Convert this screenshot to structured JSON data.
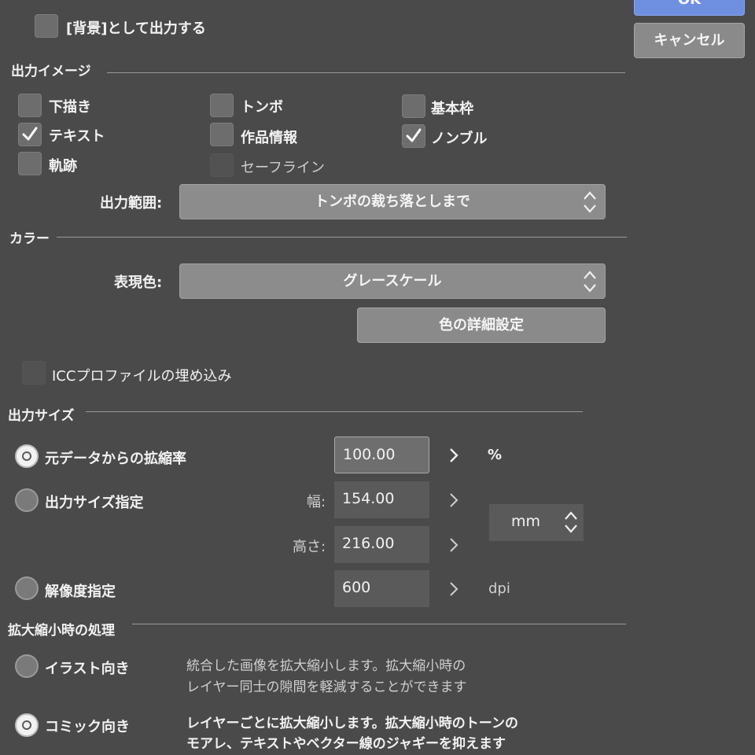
{
  "dialog": {
    "ok_label": "OK",
    "cancel_label": "キャンセル",
    "background_checkbox_label": "[背景]として出力する"
  },
  "output_image": {
    "section_title": "出力イメージ",
    "items": [
      {
        "label": "下描き",
        "checked": false
      },
      {
        "label": "トンボ",
        "checked": false
      },
      {
        "label": "基本枠",
        "checked": false
      },
      {
        "label": "テキスト",
        "checked": true
      },
      {
        "label": "作品情報",
        "checked": false
      },
      {
        "label": "ノンブル",
        "checked": true
      },
      {
        "label": "軌跡",
        "checked": false
      },
      {
        "label": "セーフライン",
        "checked": false,
        "disabled": true
      }
    ],
    "range_label": "出力範囲:",
    "range_value": "トンボの裁ち落としまで"
  },
  "color": {
    "section_title": "カラー",
    "expression_label": "表現色:",
    "expression_value": "グレースケール",
    "detail_button": "色の詳細設定",
    "icc_label": "ICCプロファイルの埋め込み"
  },
  "output_size": {
    "section_title": "出力サイズ",
    "scale_option": "元データからの拡縮率",
    "scale_value": "100.00",
    "scale_unit": "%",
    "size_option": "出力サイズ指定",
    "width_label": "幅:",
    "width_value": "154.00",
    "height_label": "高さ:",
    "height_value": "216.00",
    "size_unit": "mm",
    "resolution_option": "解像度指定",
    "resolution_value": "600",
    "resolution_unit": "dpi",
    "selected": "scale"
  },
  "scaling": {
    "section_title": "拡大縮小時の処理",
    "illust_option": "イラスト向き",
    "illust_desc_1": "統合した画像を拡大縮小します。拡大縮小時の",
    "illust_desc_2": "レイヤー同士の隙間を軽減することができます",
    "comic_option": "コミック向き",
    "comic_desc_1": "レイヤーごとに拡大縮小します。拡大縮小時のトーンの",
    "comic_desc_2": "モアレ、テキストやベクター線のジャギーを抑えます",
    "selected": "comic"
  }
}
